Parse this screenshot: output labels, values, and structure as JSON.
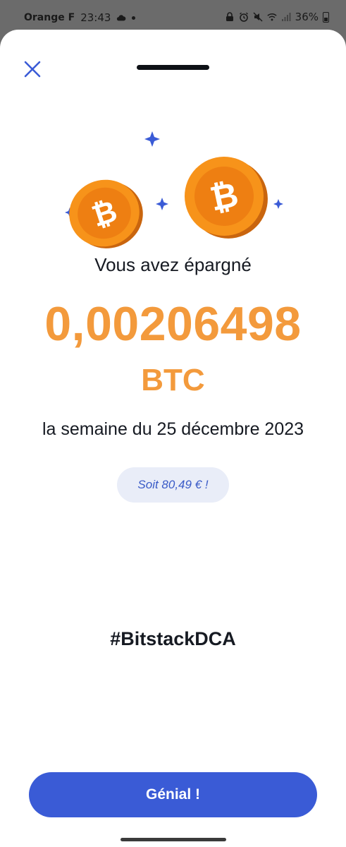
{
  "status_bar": {
    "carrier": "Orange F",
    "time": "23:43",
    "battery": "36%"
  },
  "savings": {
    "heading": "Vous avez épargné",
    "amount": "0,00206498",
    "unit": "BTC",
    "period": "la semaine du 25 décembre 2023",
    "equivalent": "Soit 80,49 € !"
  },
  "hashtag": "#BitstackDCA",
  "actions": {
    "confirm_label": "Génial !"
  },
  "colors": {
    "accent_orange": "#f39a3c",
    "primary_blue": "#3a5bd6",
    "pill_background": "#e9edf8",
    "text_dark": "#161a22"
  },
  "icons": {
    "close": "close-icon",
    "coin": "bitcoin-coin-icon",
    "sparkle": "sparkle-icon",
    "cloud": "cloud-icon",
    "wifi": "wifi-icon",
    "signal": "signal-icon",
    "battery": "battery-icon"
  }
}
